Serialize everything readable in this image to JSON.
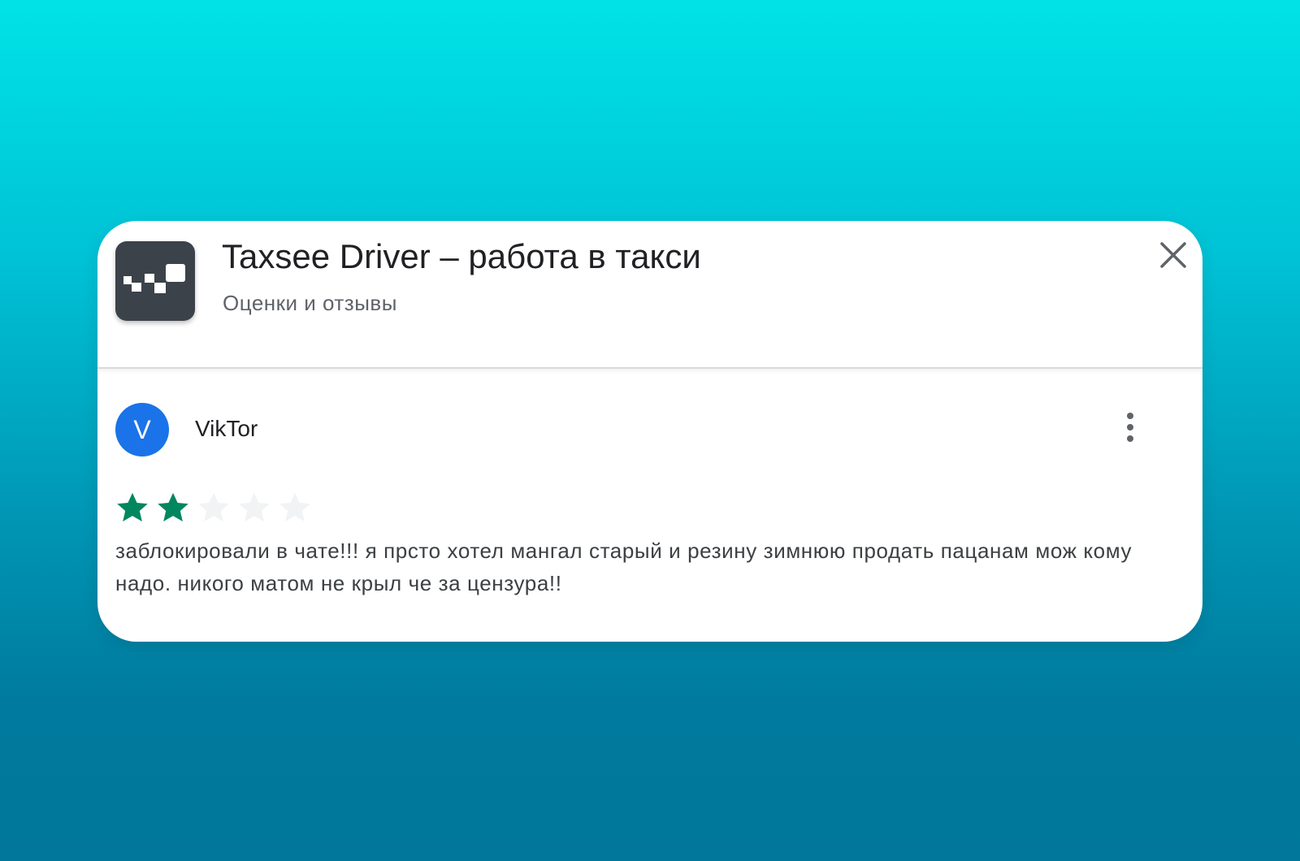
{
  "app": {
    "title": "Taxsee Driver – работа в такси",
    "subtitle": "Оценки и отзывы",
    "icon": "taxi-checker-icon"
  },
  "icons": {
    "close": "close-icon",
    "more": "more-vertical-icon"
  },
  "review": {
    "avatar_letter": "V",
    "reviewer_name": "VikTor",
    "rating": 2,
    "max_rating": 5,
    "text": "заблокировали в чате!!! я прсто хотел мангал старый и резину зимнюю продать пацанам мож кому надо. никого матом не крыл че за цензура!!"
  },
  "colors": {
    "background_top": "#00e3e6",
    "background_bottom": "#00779b",
    "avatar": "#1a73e8",
    "star_filled": "#01875f",
    "star_empty": "#f1f3f4",
    "app_icon_bg": "#3c4249"
  }
}
